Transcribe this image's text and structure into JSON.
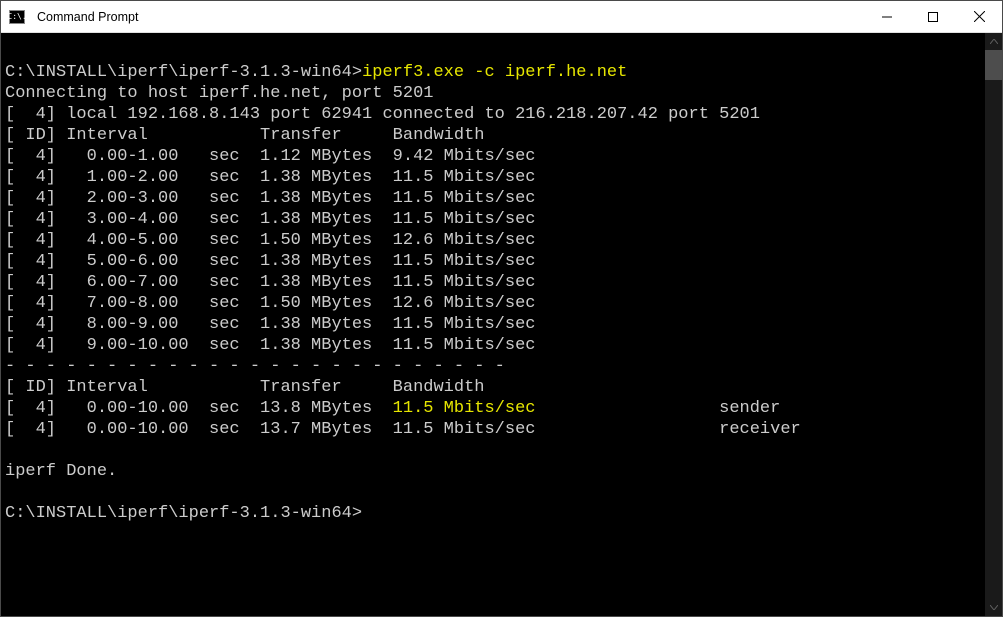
{
  "window": {
    "title": "Command Prompt",
    "icon_label": "C:\\."
  },
  "prompt": {
    "path": "C:\\INSTALL\\iperf\\iperf-3.1.3-win64>",
    "command": "iperf3.exe -c iperf.he.net"
  },
  "output": {
    "connecting": "Connecting to host iperf.he.net, port 5201",
    "local": "[  4] local 192.168.8.143 port 62941 connected to 216.218.207.42 port 5201",
    "header": "[ ID] Interval           Transfer     Bandwidth",
    "rows": [
      "[  4]   0.00-1.00   sec  1.12 MBytes  9.42 Mbits/sec",
      "[  4]   1.00-2.00   sec  1.38 MBytes  11.5 Mbits/sec",
      "[  4]   2.00-3.00   sec  1.38 MBytes  11.5 Mbits/sec",
      "[  4]   3.00-4.00   sec  1.38 MBytes  11.5 Mbits/sec",
      "[  4]   4.00-5.00   sec  1.50 MBytes  12.6 Mbits/sec",
      "[  4]   5.00-6.00   sec  1.38 MBytes  11.5 Mbits/sec",
      "[  4]   6.00-7.00   sec  1.38 MBytes  11.5 Mbits/sec",
      "[  4]   7.00-8.00   sec  1.50 MBytes  12.6 Mbits/sec",
      "[  4]   8.00-9.00   sec  1.38 MBytes  11.5 Mbits/sec",
      "[  4]   9.00-10.00  sec  1.38 MBytes  11.5 Mbits/sec"
    ],
    "separator": "- - - - - - - - - - - - - - - - - - - - - - - - -",
    "summary_header": "[ ID] Interval           Transfer     Bandwidth",
    "summary_sender_pre": "[  4]   0.00-10.00  sec  13.8 MBytes  ",
    "summary_sender_hl": "11.5 Mbits/sec",
    "summary_sender_post": "                  sender",
    "summary_receiver": "[  4]   0.00-10.00  sec  13.7 MBytes  11.5 Mbits/sec                  receiver",
    "done": "iperf Done."
  },
  "prompt2": {
    "path": "C:\\INSTALL\\iperf\\iperf-3.1.3-win64>"
  }
}
